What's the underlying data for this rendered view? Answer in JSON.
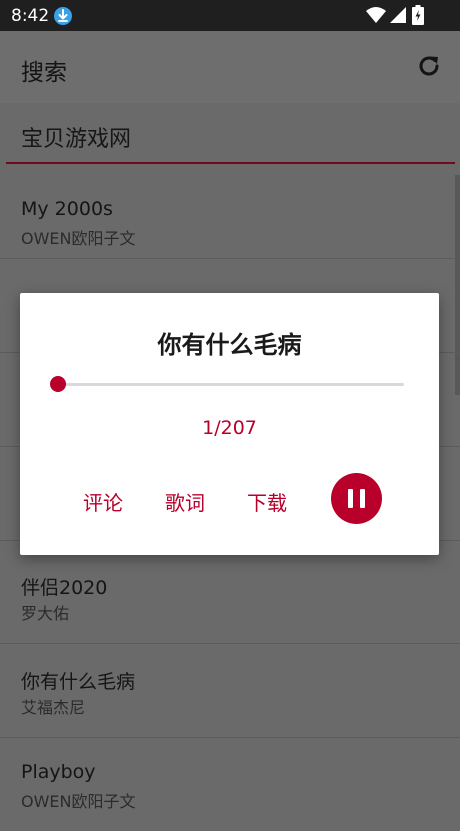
{
  "status_bar": {
    "time": "8:42"
  },
  "app_bar": {
    "title": "搜索"
  },
  "search": {
    "value": "宝贝游戏网"
  },
  "songs": [
    {
      "title": "My 2000s",
      "artist": "OWEN欧阳子文"
    },
    {
      "title": "",
      "artist": ""
    },
    {
      "title": "",
      "artist": ""
    },
    {
      "title": "",
      "artist": ""
    },
    {
      "title": "伴侣2020",
      "artist": "罗大佑"
    },
    {
      "title": "你有什么毛病",
      "artist": "艾福杰尼"
    },
    {
      "title": "Playboy",
      "artist": "OWEN欧阳子文"
    }
  ],
  "player_dialog": {
    "title": "你有什么毛病",
    "progress_text": "1/207",
    "progress": {
      "current": 1,
      "total": 207
    },
    "actions": {
      "comments": "评论",
      "lyrics": "歌词",
      "download": "下载"
    }
  },
  "colors": {
    "accent": "#b8002b",
    "status_bar": "#1f1f1f",
    "scrim": "#6a6a6a"
  },
  "icons": [
    "download-notification-icon",
    "wifi-icon",
    "signal-icon",
    "battery-charging-icon",
    "refresh-icon",
    "pause-icon"
  ]
}
